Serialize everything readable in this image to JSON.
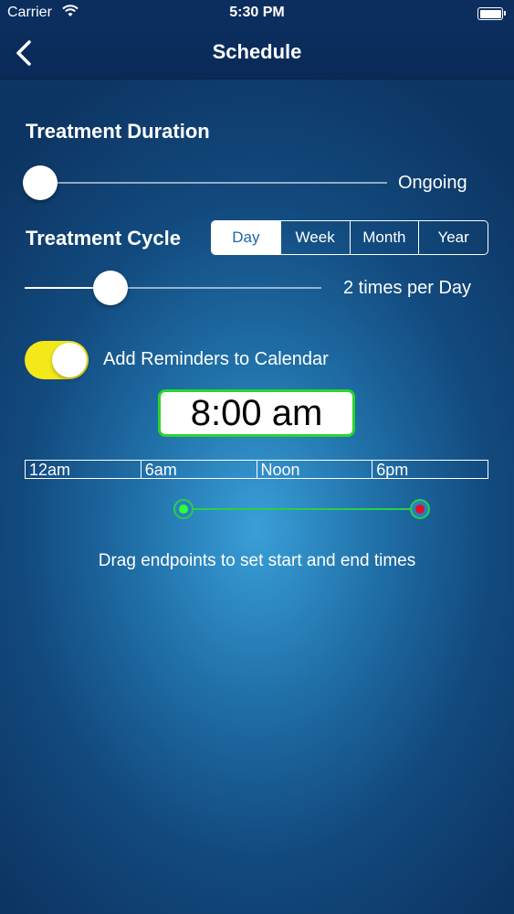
{
  "status_bar": {
    "carrier": "Carrier",
    "time": "5:30 PM"
  },
  "nav": {
    "title": "Schedule"
  },
  "treatment_duration": {
    "label": "Treatment Duration",
    "value": "Ongoing",
    "slider_level": 0
  },
  "treatment_cycle": {
    "label": "Treatment Cycle",
    "segments": [
      "Day",
      "Week",
      "Month",
      "Year"
    ],
    "selected": "Day",
    "frequency_text": "2 times per Day",
    "slider_level": 0.26
  },
  "reminders": {
    "label": "Add Reminders to Calendar",
    "enabled": true
  },
  "time_display": {
    "value": "8:00 am"
  },
  "timeline": {
    "ticks": [
      "12am",
      "6am",
      "Noon",
      "6pm"
    ],
    "hint": "Drag endpoints to set start and end times"
  },
  "colors": {
    "toggle_on": "#f5e81a",
    "accent_green": "#27cf4a",
    "end_marker": "#e0102a",
    "nav_background": "#0b2e5e"
  }
}
